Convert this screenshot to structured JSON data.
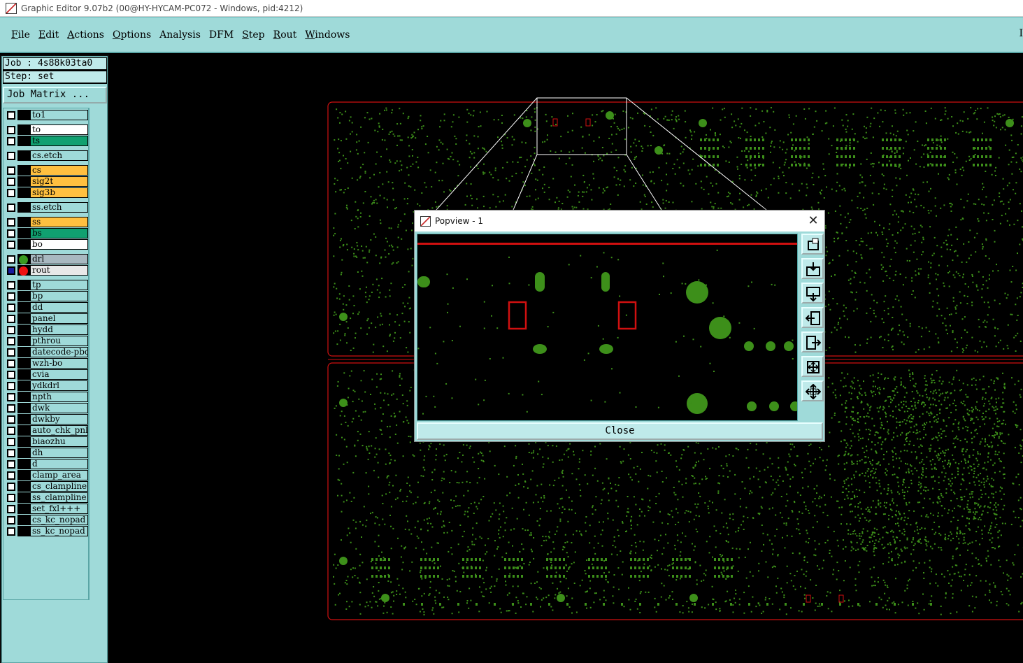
{
  "window": {
    "title": "Graphic Editor 9.07b2 (00@HY-HYCAM-PC072 - Windows, pid:4212)"
  },
  "menu": {
    "items": [
      {
        "label": "File",
        "u": "F",
        "rest": "ile"
      },
      {
        "label": "Edit",
        "u": "E",
        "rest": "dit"
      },
      {
        "label": "Actions",
        "u": "A",
        "rest": "ctions"
      },
      {
        "label": "Options",
        "u": "O",
        "rest": "ptions"
      },
      {
        "label": "Analysis",
        "u": "",
        "rest": "Analysis"
      },
      {
        "label": "DFM",
        "u": "",
        "rest": "DFM"
      },
      {
        "label": "Step",
        "u": "S",
        "rest": "tep"
      },
      {
        "label": "Rout",
        "u": "R",
        "rest": "out"
      },
      {
        "label": "Windows",
        "u": "W",
        "rest": "indows"
      }
    ],
    "right_marker": "I"
  },
  "job": {
    "job_line": "Job : 4s88k03ta0",
    "step_line": "Step: set",
    "matrix_button": "Job Matrix ..."
  },
  "layers": [
    {
      "name": "to1",
      "color": "#9fdad9",
      "checked": false
    },
    {
      "name": "to",
      "color": "#ffffff",
      "checked": false
    },
    {
      "name": "ts",
      "color": "#10a070",
      "checked": false
    },
    {
      "name": "cs.etch",
      "color": "#9fdad9",
      "checked": false
    },
    {
      "name": "cs",
      "color": "#ffc040",
      "checked": false
    },
    {
      "name": "sig2t",
      "color": "#ffc040",
      "checked": false
    },
    {
      "name": "sig3b",
      "color": "#ffc040",
      "checked": false
    },
    {
      "name": "ss.etch",
      "color": "#9fdad9",
      "checked": false
    },
    {
      "name": "ss",
      "color": "#ffc040",
      "checked": false
    },
    {
      "name": "bs",
      "color": "#10a070",
      "checked": false
    },
    {
      "name": "bo",
      "color": "#ffffff",
      "checked": false
    },
    {
      "name": "drl",
      "color": "#a8b8c0",
      "checked": false,
      "dot": "#3a9a20"
    },
    {
      "name": "rout",
      "color": "#e8e8e8",
      "checked": true,
      "dot": "#ee1111"
    },
    {
      "name": "tp",
      "color": "#9fdad9",
      "checked": false
    },
    {
      "name": "bp",
      "color": "#9fdad9",
      "checked": false
    },
    {
      "name": "dd",
      "color": "#9fdad9",
      "checked": false
    },
    {
      "name": "panel",
      "color": "#9fdad9",
      "checked": false
    },
    {
      "name": "hydd",
      "color": "#9fdad9",
      "checked": false
    },
    {
      "name": "pthrou",
      "color": "#9fdad9",
      "checked": false
    },
    {
      "name": "datecode-pbc",
      "color": "#9fdad9",
      "checked": false
    },
    {
      "name": "wzh-bo",
      "color": "#9fdad9",
      "checked": false
    },
    {
      "name": "cvia",
      "color": "#9fdad9",
      "checked": false
    },
    {
      "name": "ydkdrl",
      "color": "#9fdad9",
      "checked": false
    },
    {
      "name": "npth",
      "color": "#9fdad9",
      "checked": false
    },
    {
      "name": "dwk",
      "color": "#9fdad9",
      "checked": false
    },
    {
      "name": "dwkby",
      "color": "#9fdad9",
      "checked": false
    },
    {
      "name": "auto_chk_pnl",
      "color": "#9fdad9",
      "checked": false
    },
    {
      "name": "biaozhu",
      "color": "#9fdad9",
      "checked": false
    },
    {
      "name": "dh",
      "color": "#9fdad9",
      "checked": false
    },
    {
      "name": "d",
      "color": "#9fdad9",
      "checked": false
    },
    {
      "name": "clamp_area",
      "color": "#9fdad9",
      "checked": false
    },
    {
      "name": "cs_clampline",
      "color": "#9fdad9",
      "checked": false
    },
    {
      "name": "ss_clampline",
      "color": "#9fdad9",
      "checked": false
    },
    {
      "name": "set_fxl+++",
      "color": "#9fdad9",
      "checked": false
    },
    {
      "name": "cs_kc_nopad",
      "color": "#9fdad9",
      "checked": false
    },
    {
      "name": "ss_kc_nopad",
      "color": "#9fdad9",
      "checked": false
    }
  ],
  "popview": {
    "title": "Popview - 1",
    "close_x": "✕",
    "close_button": "Close",
    "tools": [
      "zoom-window-icon",
      "zoom-in-icon",
      "zoom-out-icon",
      "pan-left-icon",
      "pan-right-icon",
      "zoom-home-icon",
      "zoom-fit-icon"
    ]
  },
  "colors": {
    "panel": "#9fdad9",
    "trace_green": "#3d8f1a",
    "outline_red": "#d01010",
    "canvas_bg": "#000000"
  }
}
